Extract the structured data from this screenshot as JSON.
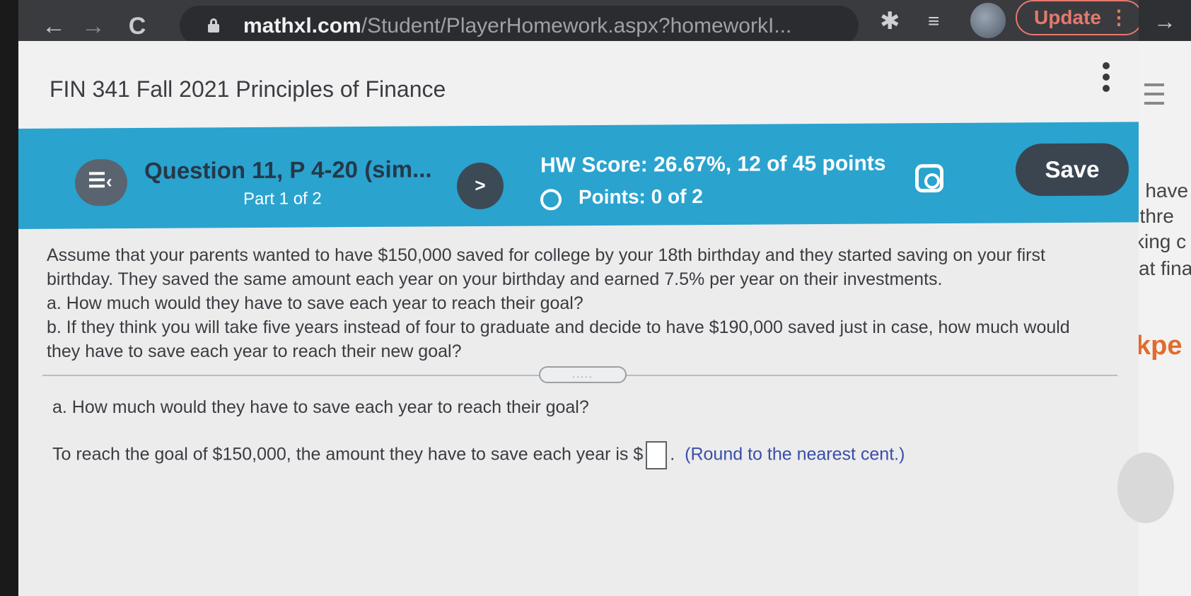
{
  "browser": {
    "url_domain": "mathxl.com",
    "url_path": "/Student/PlayerHomework.aspx?homeworkI...",
    "update_label": "Update",
    "update_menu": "⋮",
    "back_icon": "←",
    "forward_icon": "→",
    "reload_icon": "C",
    "star_icon": "☆",
    "puzzle_icon": "✱",
    "right_arrow": "→"
  },
  "course": {
    "title": "FIN 341 Fall 2021 Principles of Finance"
  },
  "question_bar": {
    "title": "Question 11, P 4-20 (sim...",
    "part": "Part 1 of 2",
    "next_label": ">",
    "hw_score": "HW Score: 26.67%, 12 of 45 points",
    "points": "Points: 0 of 2",
    "save_label": "Save"
  },
  "problem": {
    "intro": "Assume that your parents wanted to have $150,000 saved for college by your 18th birthday and they started saving on your first birthday. They saved the same amount each year on your birthday and earned 7.5% per year on their investments.",
    "part_a": "a. How much would they have to save each year to reach their goal?",
    "part_b": "b. If they think you will take five years instead of four to graduate and decide to have $190,000 saved just in case, how much would they have to save each year to reach their new goal?"
  },
  "handle_label": ".....",
  "answer_section": {
    "question": "a. How much would they have to save each year to reach their goal?",
    "prefix": "To reach the goal of $150,000, the amount they have to save each year is $",
    "suffix": ".",
    "note": "(Round to the nearest cent.)",
    "input_value": ""
  },
  "background_window": {
    "lines": [
      "u have",
      "t thre",
      "king c",
      "at fina"
    ],
    "orange_text": "kpe"
  }
}
